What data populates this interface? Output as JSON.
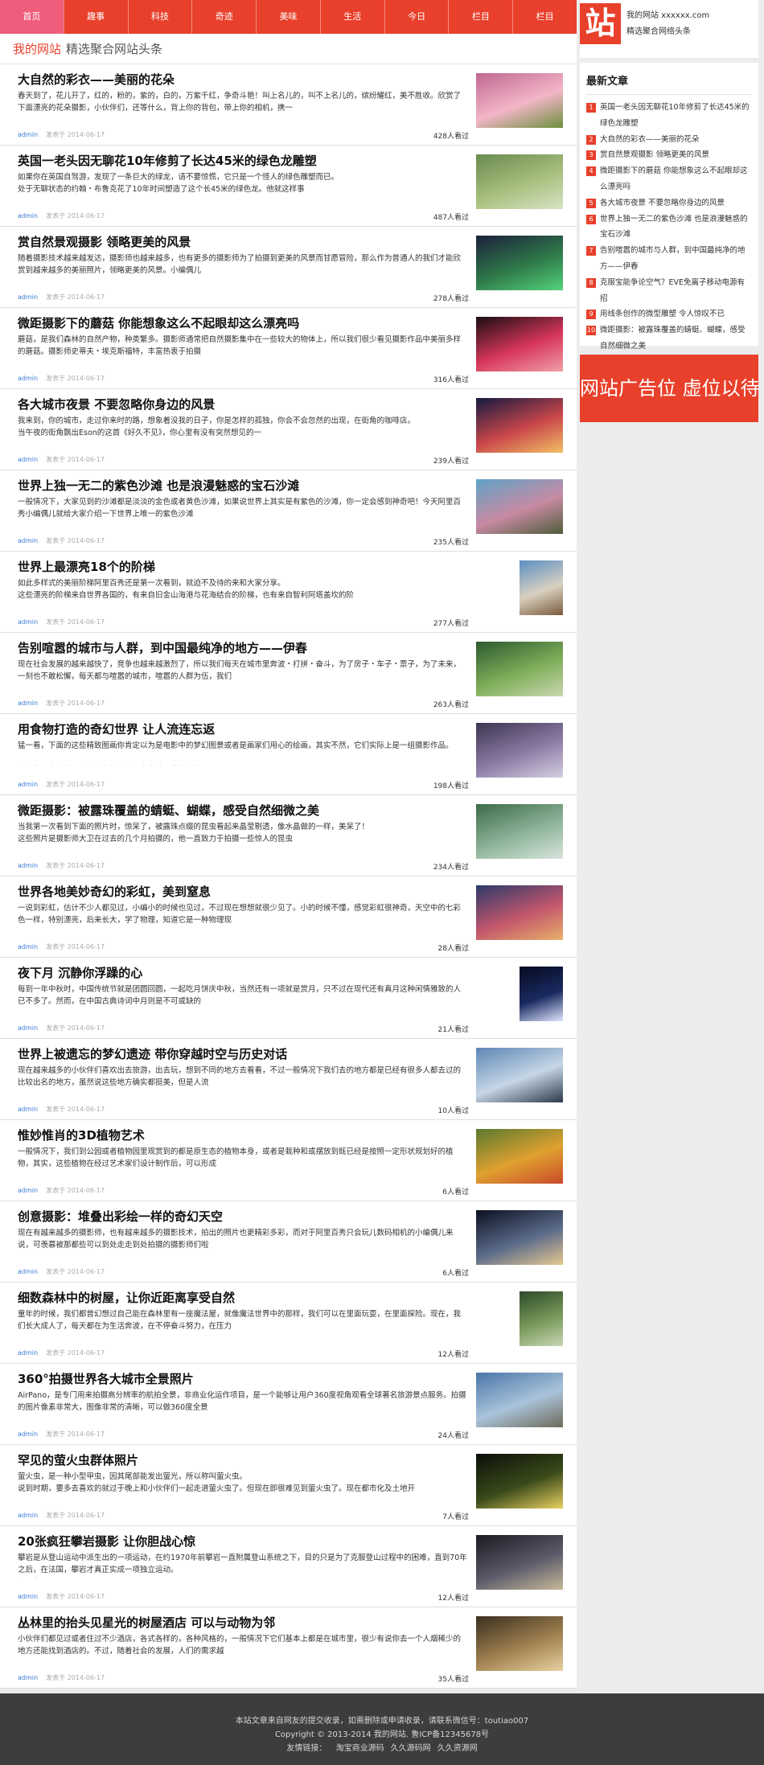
{
  "nav": [
    "首页",
    "趣事",
    "科技",
    "奇迹",
    "美味",
    "生活",
    "今日",
    "栏目",
    "栏目"
  ],
  "crumb": {
    "site": "我的网站",
    "tagline": "精选聚合网站头条"
  },
  "articles": [
    {
      "title": "大自然的彩衣——美丽的花朵",
      "summary": "春天到了，花儿开了，红的，粉的，紫的，白的，万紫千红，争奇斗艳！叫上名儿的，叫不上名儿的，缤纷耀红，美不胜收。欣赏了下面漂亮的花朵摄影，小伙伴们，还等什么，背上你的背包，带上你的相机，携一",
      "author": "admin",
      "posted": "发表于 2014-06-17",
      "views": "428人看过",
      "thumb": [
        "#c06790",
        "#f3b6c8",
        "#6b8f3c"
      ],
      "narrow": false
    },
    {
      "title": "英国一老头因无聊花10年修剪了长达45米的绿色龙雕塑",
      "summary": "如果你在英国自驾游，发现了一条巨大的绿龙，请不要惊慌，它只是一个怪人的绿色雕塑而已。\n处于无聊状态的约翰・布鲁克花了10年时间塑造了这个长45米的绿色龙。他就这样事",
      "author": "admin",
      "posted": "发表于 2014-06-17",
      "views": "487人看过",
      "thumb": [
        "#6a8a4f",
        "#a7c07e",
        "#d8e3c4"
      ],
      "narrow": false
    },
    {
      "title": "赏自然景观摄影 领略更美的风景",
      "summary": "随着摄影技术越来越发达，摄影师也越来越多，也有更多的摄影师为了拍摄到更美的风景而甘愿冒险，那么作为普通人的我们才能欣赏到越来越多的美丽照片，领略更美的风景。小编偶儿",
      "author": "admin",
      "posted": "发表于 2014-06-17",
      "views": "278人看过",
      "thumb": [
        "#1b1f3a",
        "#2f7a4a",
        "#54d27a"
      ],
      "narrow": false
    },
    {
      "title": "微距摄影下的蘑菇 你能想象这么不起眼却这么漂亮吗",
      "summary": "蘑菇，是我们森林的自然产物，种类繁多。摄影师通常把自然摄影集中在一些较大的物体上，所以我们很少看见摄影作品中美丽多样的蘑菇。摄影师史蒂夫・埃克斯福特，丰富热衷于拍摄",
      "author": "admin",
      "posted": "发表于 2014-06-17",
      "views": "316人看过",
      "thumb": [
        "#1a0d12",
        "#d7365a",
        "#f0a0a8"
      ],
      "narrow": false
    },
    {
      "title": "各大城市夜景 不要忽略你身边的风景",
      "summary": "我来到，你的城市，走过你来时的路，想象着没我的日子，你是怎样的孤独，你会不会忽然的出现，在街角的咖啡店。\n当午夜的街角飘出Eson的这首《好久不见》，你心里有没有突然想见的一",
      "author": "admin",
      "posted": "发表于 2014-06-17",
      "views": "239人看过",
      "thumb": [
        "#151a40",
        "#c9464a",
        "#f1c065"
      ],
      "narrow": false
    },
    {
      "title": "世界上独一无二的紫色沙滩 也是浪漫魅惑的宝石沙滩",
      "summary": "一般情况下，大家见到的沙滩都是淡淡的金色或者黄色沙滩，如果说世界上其实是有紫色的沙滩，你一定会感到神奇吧！今天阿里百秀小编偶儿就给大家介绍一下世界上唯一的紫色沙滩",
      "author": "admin",
      "posted": "发表于 2014-06-17",
      "views": "235人看过",
      "thumb": [
        "#5fa3c7",
        "#c88aa3",
        "#4e5d3a"
      ],
      "narrow": false
    },
    {
      "title": "世界上最漂亮18个的阶梯",
      "summary": "如此多样式的美丽阶梯阿里百秀还是第一次看到，就迫不及待的来和大家分享。\n这些漂亮的阶梯来自世界各国的，有来自旧金山海港与花海结合的阶梯，也有来自智利阿塔盖坎的阶",
      "author": "admin",
      "posted": "发表于 2014-06-17",
      "views": "277人看过",
      "thumb": [
        "#5c8fc4",
        "#d8d0c0",
        "#7a5b3c"
      ],
      "narrow": true
    },
    {
      "title": "告别喧嚣的城市与人群，到中国最纯净的地方——伊春",
      "summary": "现在社会发展的越来越快了，竞争也越来越激烈了，所以我们每天在城市里奔波・打拼・奋斗，为了房子・车子・票子，为了未来，一刻也不敢松懈，每天都与喧嚣的城市，喧嚣的人群为伍，我们",
      "author": "admin",
      "posted": "发表于 2014-06-17",
      "views": "263人看过",
      "thumb": [
        "#2d5a2e",
        "#7fae5a",
        "#c9d7b0"
      ],
      "narrow": false
    },
    {
      "title": "用食物打造的奇幻世界 让人流连忘返",
      "summary": "猛一看，下面的这些精致图画你肯定以为是电影中的梦幻图景或者是画家们用心的绘画，其实不然，它们实际上是一组摄影作品。\n\n也许你不太相信，事实上它们确实是出自英国伦敦专业",
      "author": "admin",
      "posted": "发表于 2014-06-17",
      "views": "198人看过",
      "thumb": [
        "#3d3550",
        "#8c7ca6",
        "#d6cfe0"
      ],
      "narrow": false
    },
    {
      "title": "微距摄影：被露珠覆盖的蜻蜓、蝴蝶，感受自然细微之美",
      "summary": "当我第一次看到下面的照片时，惊呆了，被露珠点缀的昆虫看起来晶莹剔透，像水晶做的一样，美呆了！\n这些照片是摄影师大卫在过去的几个月拍摄的，他一直致力于拍摄一些惊人的昆虫",
      "author": "admin",
      "posted": "发表于 2014-06-17",
      "views": "234人看过",
      "thumb": [
        "#3d6a4a",
        "#8fb59a",
        "#d7e4dc"
      ],
      "narrow": false
    },
    {
      "title": "世界各地美妙奇幻的彩虹，美到窒息",
      "summary": "一说到彩虹，估计不少人都见过，小编小的时候也见过，不过现在想想就很少见了。小的时候不懂，感觉彩虹很神奇，天空中的七彩色一样，特别漂亮，后来长大，学了物理，知道它是一种物理现",
      "author": "admin",
      "posted": "发表于 2014-06-17",
      "views": "28人看过",
      "thumb": [
        "#2c3a6a",
        "#c2566c",
        "#e8b06a"
      ],
      "narrow": false
    },
    {
      "title": "夜下月 沉静你浮躁的心",
      "summary": "每到一年中秋时，中国传统节就是团圆回圆，一起吃月饼庆中秋，当然还有一项就是赏月，只不过在现代还有真月这种闲情雅致的人已不多了。然而，在中国古典诗词中月则是不可或缺的",
      "author": "admin",
      "posted": "发表于 2014-06-17",
      "views": "21人看过",
      "thumb": [
        "#050a20",
        "#1a2a60",
        "#dfe6ff"
      ],
      "narrow": true
    },
    {
      "title": "世界上被遗忘的梦幻遗迹 带你穿越时空与历史对话",
      "summary": "现在越来越多的小伙伴们喜欢出去旅游，出去玩，想到不同的地方去看看，不过一般情况下我们去的地方都是已经有很多人都去过的比较出名的地方，虽然说这些地方确实都挺美，但是人流",
      "author": "admin",
      "posted": "发表于 2014-06-17",
      "views": "10人看过",
      "thumb": [
        "#5d86b5",
        "#c6d6e6",
        "#2a3a4a"
      ],
      "narrow": false
    },
    {
      "title": "惟妙惟肖的3D植物艺术",
      "summary": "一般情况下，我们到公园或者植物园里观赏到的都是原生态的植物本身，或者是栽种和或摆放到既已经是按照一定形状规划好的植物，其实，这些植物在经过艺术家们设计制作后，可以形成",
      "author": "admin",
      "posted": "发表于 2014-06-17",
      "views": "6人看过",
      "thumb": [
        "#5a7a2e",
        "#e0a030",
        "#c84a2a"
      ],
      "narrow": false
    },
    {
      "title": "创意摄影：堆叠出彩绘一样的奇幻天空",
      "summary": "现在有越来越多的摄影师，也有越来越多的摄影技术，拍出的照片也更精彩多彩，而对于阿里百秀只会玩儿数码相机的小编偶儿来说，可羡慕被那都些可以到处走走到处拍摄的摄影师们啦",
      "author": "admin",
      "posted": "发表于 2014-06-17",
      "views": "6人看过",
      "thumb": [
        "#0c1020",
        "#5a6a8a",
        "#e6c890"
      ],
      "narrow": false
    },
    {
      "title": "细数森林中的树屋，让你近距离享受自然",
      "summary": "童年的时候，我们都曾幻想过自己能在森林里有一座魔法屋，就像魔法世界中的那样，我们可以在里面玩耍，在里面探险。现在，我们长大成人了，每天都在为生活奔波，在不停奋斗努力，在压力",
      "author": "admin",
      "posted": "发表于 2014-06-17",
      "views": "12人看过",
      "thumb": [
        "#2c4a2a",
        "#7a9a5a",
        "#c7d7b7"
      ],
      "narrow": true
    },
    {
      "title": "360°拍摄世界各大城市全景照片",
      "summary": "AirPano，是专门用来拍摄高分辨率的航拍全景，非商业化运作项目，是一个能够让用户360度视角观看全球著名旅游景点服务。拍摄的图片像素非常大，图像非常的清晰，可以做360度全景",
      "author": "admin",
      "posted": "发表于 2014-06-17",
      "views": "24人看过",
      "thumb": [
        "#4a76a8",
        "#a9c3da",
        "#6e6a5a"
      ],
      "narrow": false
    },
    {
      "title": "罕见的萤火虫群体照片",
      "summary": "萤火虫，是一种小型甲虫，因其尾部能发出萤光，所以称叫萤火虫。\n说到时期，要多去喜欢的就过于晚上和小伙伴们一起走进萤火虫了。但现在即很难见到萤火虫了。现在都市化及土地开",
      "author": "admin",
      "posted": "发表于 2014-06-17",
      "views": "7人看过",
      "thumb": [
        "#0a0f0a",
        "#3a4a1a",
        "#e8d060"
      ],
      "narrow": false
    },
    {
      "title": "20张疯狂攀岩摄影 让你胆战心惊",
      "summary": "攀岩是从登山运动中派生出的一项运动，在约1970年前攀岩一直附属登山系统之下，目的只是为了克服登山过程中的困难，直到70年之后，在法国，攀岩才真正实成一项独立运动。\n如果你恐",
      "author": "admin",
      "posted": "发表于 2014-06-17",
      "views": "12人看过",
      "thumb": [
        "#1a1a22",
        "#5a5a6a",
        "#c8b89a"
      ],
      "narrow": false
    },
    {
      "title": "丛林里的抬头见星光的树屋酒店 可以与动物为邻",
      "summary": "小伙伴们都见过或者住过不少酒店，各式各样的，各种风格的，一般情况下它们基本上都是在城市里，很少有说你去一个人烟稀少的地方还能找到酒店的。不过，随着社会的发展，人们的需求越",
      "author": "admin",
      "posted": "发表于 2014-06-17",
      "views": "35人看过",
      "thumb": [
        "#3a3020",
        "#a08050",
        "#e8d0a0"
      ],
      "narrow": false
    }
  ],
  "side": {
    "brand": {
      "logo": "站",
      "line1": "我的网站 xxxxxx.com",
      "line2": "精选聚合网络头条"
    },
    "latest_title": "最新文章",
    "latest": [
      "英国一老头因无聊花10年修剪了长达45米的绿色龙雕塑",
      "大自然的彩衣——美丽的花朵",
      "赏自然景观摄影 领略更美的风景",
      "微距摄影下的蘑菇 你能想象这么不起眼却这么漂亮吗",
      "各大城市夜景 不要忽略你身边的风景",
      "世界上独一无二的紫色沙滩 也是浪漫魅惑的宝石沙滩",
      "告别喧嚣的城市与人群，到中国最纯净的地方——伊春",
      "克服宝能争论空气？EVE免离子移动电源有招",
      "用线条创作的微型雕塑 令人惊叹不已",
      "微距摄影：被露珠覆盖的蜻蜓、蝴蝶，感受自然细微之美"
    ],
    "ad": "网站广告位 虚位以待"
  },
  "footer": {
    "line1": "本站文章来自网友的提交收录，如需删除或申请收录，请联系微信号：toutiao007",
    "line2": "Copyright © 2013-2014 我的网站. 鲁ICP备12345678号",
    "links_label": "友情链接：",
    "links": [
      "淘宝商业源码",
      "久久源码网",
      "久久资源网"
    ]
  }
}
